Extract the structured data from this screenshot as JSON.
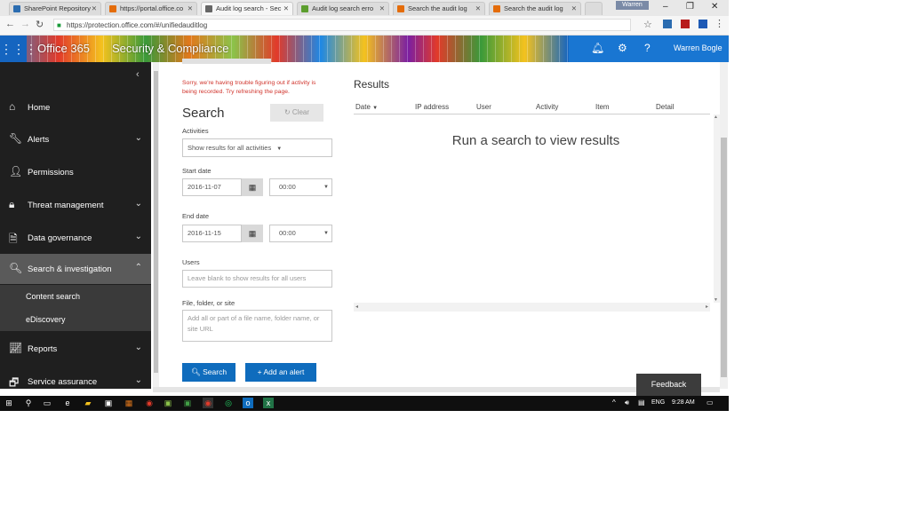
{
  "browser": {
    "tabs": [
      {
        "title": "SharePoint Repository",
        "fav_color": "#2b6cb0"
      },
      {
        "title": "https://portal.office.co",
        "fav_color": "#e46c0a"
      },
      {
        "title": "Audit log search - Sec",
        "fav_color": "#666666"
      },
      {
        "title": "Audit log search erro",
        "fav_color": "#5c9e2e"
      },
      {
        "title": "Search the audit log",
        "fav_color": "#e46c0a"
      },
      {
        "title": "Search the audit log",
        "fav_color": "#e46c0a"
      }
    ],
    "profile": "Warren",
    "url": "https://protection.office.com/#/unifiedauditlog"
  },
  "header": {
    "waffle_icon": "grid-icon",
    "product": "Office 365",
    "app": "Security & Compliance",
    "user": "Warren Bogle",
    "icons": [
      "bell-icon",
      "gear-icon",
      "help-icon"
    ]
  },
  "sidebar": {
    "items": [
      {
        "label": "Home",
        "icon": "home-icon",
        "chev": ""
      },
      {
        "label": "Alerts",
        "icon": "wrench-icon",
        "chev": "⌄"
      },
      {
        "label": "Permissions",
        "icon": "people-icon",
        "chev": ""
      },
      {
        "label": "Threat management",
        "icon": "lock-icon",
        "chev": "⌄"
      },
      {
        "label": "Data governance",
        "icon": "document-icon",
        "chev": "⌄"
      },
      {
        "label": "Search & investigation",
        "icon": "search-icon",
        "chev": "⌃"
      },
      {
        "label": "Reports",
        "icon": "chart-icon",
        "chev": "⌄"
      },
      {
        "label": "Service assurance",
        "icon": "service-icon",
        "chev": "⌄"
      }
    ],
    "subitems": [
      "Content search",
      "eDiscovery"
    ]
  },
  "form": {
    "error": "Sorry, we're having trouble figuring out if activity is being recorded. Try refreshing the page.",
    "title": "Search",
    "clear": "Clear",
    "activities_label": "Activities",
    "activities_value": "Show results for all activities",
    "start_label": "Start date",
    "start_date": "2016-11-07",
    "start_time": "00:00",
    "end_label": "End date",
    "end_date": "2016-11-15",
    "end_time": "00:00",
    "users_label": "Users",
    "users_placeholder": "Leave blank to show results for all users",
    "file_label": "File, folder, or site",
    "file_placeholder": "Add all or part of a file name, folder name, or site URL",
    "search_button": "Search",
    "alert_button": "Add an alert"
  },
  "results": {
    "title": "Results",
    "columns": [
      "Date",
      "IP address",
      "User",
      "Activity",
      "Item",
      "Detail"
    ],
    "empty": "Run a search to view results"
  },
  "feedback": "Feedback",
  "taskbar": {
    "lang": "ENG",
    "time": "9:28 AM"
  }
}
